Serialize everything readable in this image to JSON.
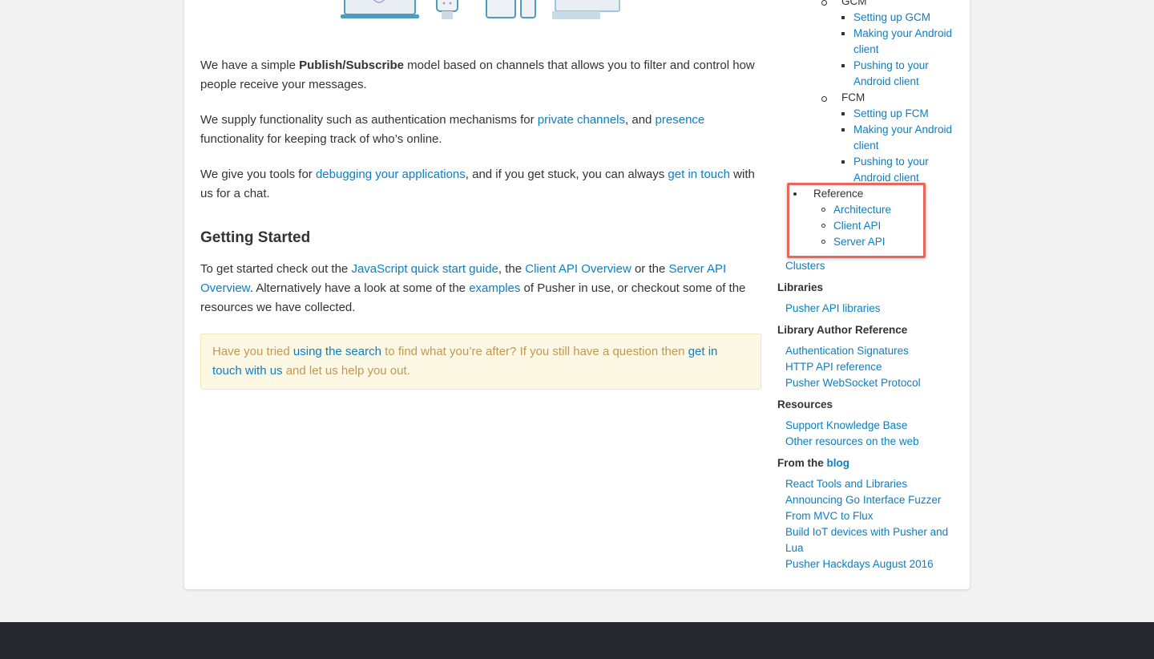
{
  "main": {
    "p1": {
      "before": "We have a simple ",
      "bold": "Publish/Subscribe",
      "after": " model based on channels that allows you to filter and control how people receive your messages."
    },
    "p2": {
      "before": "We supply functionality such as authentication mechanisms for ",
      "link1": "private channels",
      "mid": ", and ",
      "link2": "presence",
      "after": " functionality for keeping track of who’s online."
    },
    "p3": {
      "before": "We give you tools for ",
      "link1": "debugging your applications",
      "mid": ", and if you get stuck, you can always ",
      "link2": "get in touch",
      "after": " with us for a chat."
    },
    "heading": "Getting Started",
    "p4": {
      "before": "To get started check out the ",
      "link1": "JavaScript quick start guide",
      "mid1": ", the ",
      "link2": "Client API Overview",
      "mid2": " or the ",
      "link3": "Server API Overview",
      "mid3": ". Alternatively have a look at some of the ",
      "link4": "examples",
      "after": " of Pusher in use, or checkout some of the resources we have collected."
    },
    "callout": {
      "before": "Have you tried ",
      "link1": "using the search",
      "mid": " to find what you’re after? If you still have a question then ",
      "link2": "get in touch with us",
      "after": " and let us help you out."
    }
  },
  "sidebar": {
    "gcm": {
      "label": "GCM",
      "items": [
        "Setting up GCM",
        "Making your Android client",
        "Pushing to your Android client"
      ]
    },
    "fcm": {
      "label": "FCM",
      "items": [
        "Setting up FCM",
        "Making your Android client",
        "Pushing to your Android client"
      ]
    },
    "reference": {
      "label": "Reference",
      "items": [
        "Architecture",
        "Client API",
        "Server API"
      ]
    },
    "clusters": "Clusters",
    "libraries": {
      "heading": "Libraries",
      "items": [
        "Pusher API libraries"
      ]
    },
    "author_ref": {
      "heading": "Library Author Reference",
      "items": [
        "Authentication Signatures",
        "HTTP API reference",
        "Pusher WebSocket Protocol"
      ]
    },
    "resources": {
      "heading": "Resources",
      "items": [
        "Support Knowledge Base",
        "Other resources on the web"
      ]
    },
    "blog": {
      "heading_prefix": "From the ",
      "heading_link": "blog",
      "items": [
        "React Tools and Libraries",
        "Announcing Go Interface Fuzzer",
        "From MVC to Flux",
        "Build IoT devices with Pusher and Lua",
        "Pusher Hackdays August 2016"
      ]
    }
  },
  "colors": {
    "link": "#0a7fc4",
    "highlight": "#e8665a",
    "callout_bg": "#fcf8e3",
    "callout_text": "#c09853",
    "footer": "#25272e"
  }
}
